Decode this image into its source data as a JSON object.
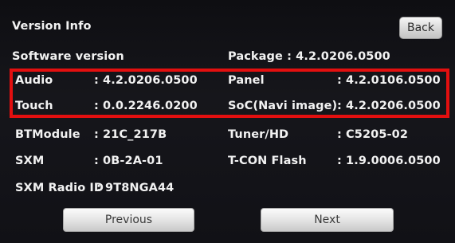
{
  "header": {
    "title": "Version Info",
    "back_label": "Back"
  },
  "software": {
    "label": "Software version",
    "package": "Package : 4.2.0206.0500"
  },
  "left_rows": [
    {
      "label": "Audio",
      "value": ": 4.2.0206.0500"
    },
    {
      "label": "Touch",
      "value": ": 0.0.2246.0200"
    },
    {
      "label": "BTModule",
      "value": ": 21C_217B"
    },
    {
      "label": "SXM",
      "value": ": 0B-2A-01"
    }
  ],
  "right_rows": [
    {
      "label": "Panel",
      "value": ": 4.2.0106.0500"
    },
    {
      "label": "SoC(Navi image)",
      "value": ": 4.2.0206.0500"
    },
    {
      "label": "Tuner/HD",
      "value": ": C5205-02"
    },
    {
      "label": "T-CON Flash",
      "value": ": 1.9.0006.0500"
    }
  ],
  "sxm_radio": {
    "label": "SXM Radio ID",
    "value": ": 9T8NGA44"
  },
  "footer": {
    "previous_label": "Previous",
    "next_label": "Next"
  },
  "colors": {
    "highlight": "#e30f0f",
    "background": "#131318",
    "text": "#f2f2f2"
  }
}
